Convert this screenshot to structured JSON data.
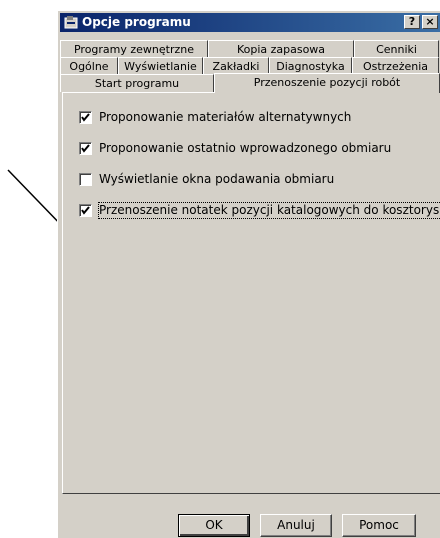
{
  "window": {
    "title": "Opcje programu",
    "help_button": "?",
    "close_button": "×"
  },
  "tabs": {
    "row1": [
      "Programy zewnętrzne",
      "Kopia zapasowa",
      "Cenniki"
    ],
    "row2": [
      "Ogólne",
      "Wyświetlanie",
      "Zakładki",
      "Diagnostyka",
      "Ostrzeżenia"
    ],
    "row3": [
      "Start programu",
      "Przenoszenie pozycji robót"
    ],
    "active": "Przenoszenie pozycji robót"
  },
  "options": [
    {
      "label": "Proponowanie materiałów alternatywnych",
      "checked": true
    },
    {
      "label": "Proponowanie ostatnio wprowadzonego obmiaru",
      "checked": true
    },
    {
      "label": "Wyświetlanie okna podawania obmiaru",
      "checked": false
    },
    {
      "label": "Przenoszenie notatek pozycji katalogowych do kosztorysu",
      "checked": true
    }
  ],
  "buttons": {
    "ok": "OK",
    "cancel": "Anuluj",
    "help": "Pomoc"
  },
  "icons": {
    "title_icon": "settings-dialog-icon",
    "annotation": "arrow-pointer-icon"
  },
  "colors": {
    "titlebar_start": "#0a246a",
    "titlebar_end": "#3a6ea5",
    "face": "#d4d0c8"
  }
}
